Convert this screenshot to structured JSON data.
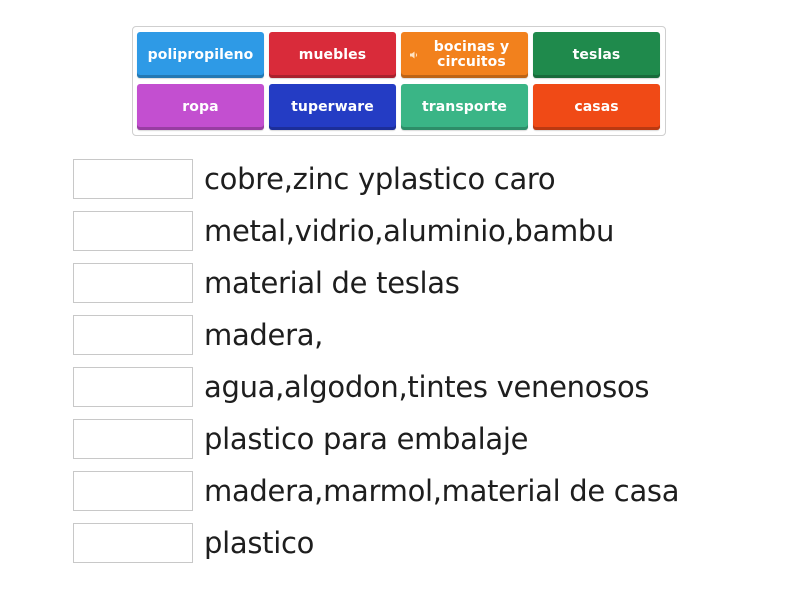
{
  "tiles": [
    {
      "label": "polipropileno",
      "color": "#2e9ae6",
      "audio": false
    },
    {
      "label": "muebles",
      "color": "#d92b3a",
      "audio": false
    },
    {
      "label": "bocinas y circuitos",
      "line1": "bocinas y",
      "line2": "circuitos",
      "color": "#f2811d",
      "audio": true
    },
    {
      "label": "teslas",
      "color": "#1f8a4c",
      "audio": false
    },
    {
      "label": "ropa",
      "color": "#c34fd0",
      "audio": false
    },
    {
      "label": "tuperware",
      "color": "#243cc4",
      "audio": false
    },
    {
      "label": "transporte",
      "color": "#3ab586",
      "audio": false
    },
    {
      "label": "casas",
      "color": "#f04a16",
      "audio": false
    }
  ],
  "clues": [
    "cobre,zinc yplastico caro",
    "metal,vidrio,aluminio,bambu",
    "material de teslas",
    "madera,",
    "agua,algodon,tintes venenosos",
    "plastico para embalaje",
    "madera,marmol,material de casa",
    "plastico"
  ],
  "icons": {
    "audio": "speaker-icon"
  }
}
